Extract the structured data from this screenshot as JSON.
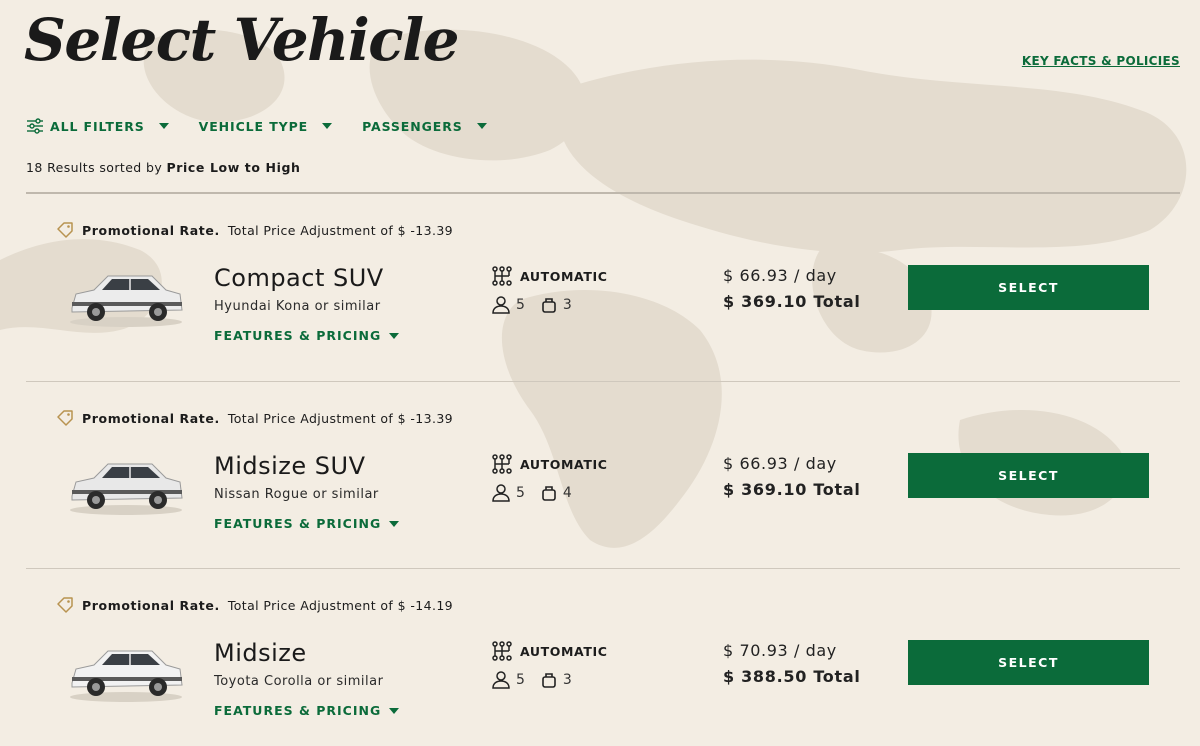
{
  "page": {
    "title": "Select Vehicle",
    "key_facts_link": "KEY FACTS & POLICIES"
  },
  "filters": [
    {
      "label": "ALL FILTERS",
      "icon": "sliders-icon"
    },
    {
      "label": "VEHICLE TYPE"
    },
    {
      "label": "PASSENGERS"
    }
  ],
  "results": {
    "prefix": "18 Results sorted by",
    "sort": "Price Low to High"
  },
  "colors": {
    "accent": "#0b6b3a",
    "background": "#f3ede3"
  },
  "vehicles": [
    {
      "promo_label": "Promotional Rate.",
      "promo_detail": "Total Price Adjustment of $ -13.39",
      "name": "Compact SUV",
      "model": "Hyundai Kona or similar",
      "features_label": "FEATURES & PRICING",
      "transmission": "AUTOMATIC",
      "passengers": "5",
      "bags": "3",
      "per_day": "$ 66.93 / day",
      "total": "$ 369.10 Total",
      "select_label": "SELECT",
      "car_color": "#ececec"
    },
    {
      "promo_label": "Promotional Rate.",
      "promo_detail": "Total Price Adjustment of $ -13.39",
      "name": "Midsize SUV",
      "model": "Nissan Rogue or similar",
      "features_label": "FEATURES & PRICING",
      "transmission": "AUTOMATIC",
      "passengers": "5",
      "bags": "4",
      "per_day": "$ 66.93 / day",
      "total": "$ 369.10 Total",
      "select_label": "SELECT",
      "car_color": "#e8e8e8"
    },
    {
      "promo_label": "Promotional Rate.",
      "promo_detail": "Total Price Adjustment of $ -14.19",
      "name": "Midsize",
      "model": "Toyota Corolla or similar",
      "features_label": "FEATURES & PRICING",
      "transmission": "AUTOMATIC",
      "passengers": "5",
      "bags": "3",
      "per_day": "$ 70.93 / day",
      "total": "$ 388.50 Total",
      "select_label": "SELECT",
      "car_color": "#f2f2f2"
    }
  ]
}
